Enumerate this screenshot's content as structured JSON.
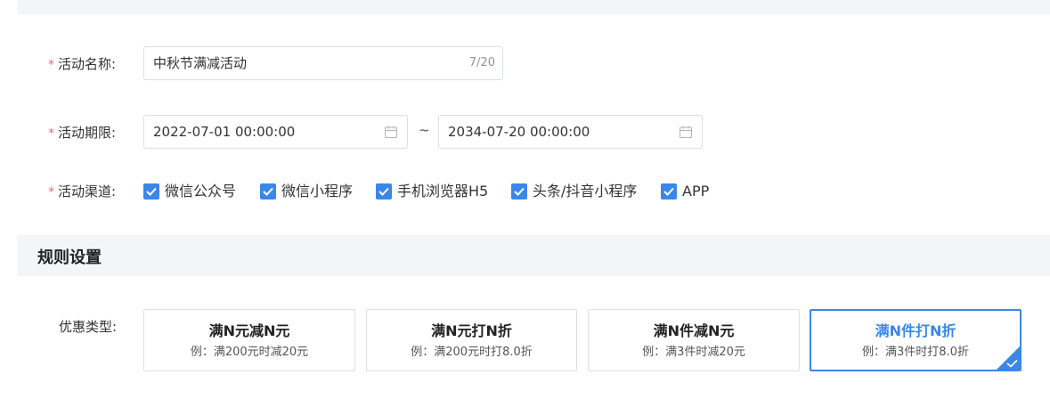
{
  "form": {
    "name": {
      "label": "活动名称:",
      "value": "中秋节满减活动",
      "count": "7/20"
    },
    "period": {
      "label": "活动期限:",
      "start": "2022-07-01 00:00:00",
      "separator": "~",
      "end": "2034-07-20 00:00:00"
    },
    "channels": {
      "label": "活动渠道:",
      "items": [
        {
          "label": "微信公众号",
          "checked": true
        },
        {
          "label": "微信小程序",
          "checked": true
        },
        {
          "label": "手机浏览器H5",
          "checked": true
        },
        {
          "label": "头条/抖音小程序",
          "checked": true
        },
        {
          "label": "APP",
          "checked": true
        }
      ]
    },
    "required_mark": "*"
  },
  "rules": {
    "section_title": "规则设置",
    "type_label": "优惠类型:",
    "types": [
      {
        "title": "满N元减N元",
        "example": "例：满200元时减20元",
        "selected": false
      },
      {
        "title": "满N元打N折",
        "example": "例：满200元时打8.0折",
        "selected": false
      },
      {
        "title": "满N件减N元",
        "example": "例：满3件时减20元",
        "selected": false
      },
      {
        "title": "满N件打N折",
        "example": "例：满3件时打8.0折",
        "selected": true
      }
    ]
  },
  "colors": {
    "accent": "#3a87e8",
    "required": "#f56c6c",
    "section_bg": "#f4f5f7"
  },
  "icons": {
    "date": "calendar-icon",
    "check": "check-icon"
  }
}
